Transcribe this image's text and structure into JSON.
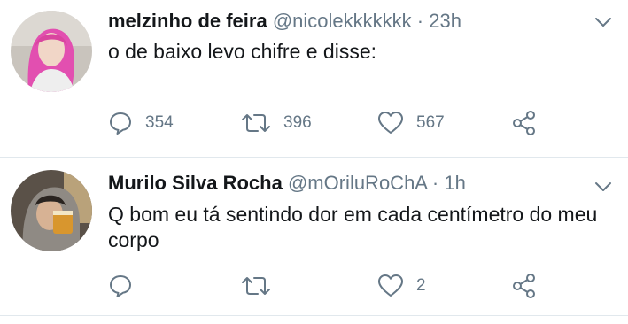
{
  "tweets": [
    {
      "display_name": "melzinho de feira",
      "handle": "@nicolekkkkkkk",
      "separator": "·",
      "time": "23h",
      "text": "o de baixo levo chifre e disse:",
      "reply_count": "354",
      "retweet_count": "396",
      "like_count": "567"
    },
    {
      "display_name": "Murilo Silva Rocha",
      "handle": "@mOriluRoChA",
      "separator": "·",
      "time": "1h",
      "text": "Q bom eu tá sentindo dor em cada centímetro do meu corpo",
      "reply_count": "",
      "retweet_count": "",
      "like_count": "2"
    }
  ],
  "icons": {
    "reply": "reply-icon",
    "retweet": "retweet-icon",
    "like": "heart-icon",
    "share": "share-icon",
    "caret": "chevron-down-icon"
  },
  "colors": {
    "text": "#14171a",
    "secondary": "#657786",
    "divider": "#e1e8ed"
  }
}
